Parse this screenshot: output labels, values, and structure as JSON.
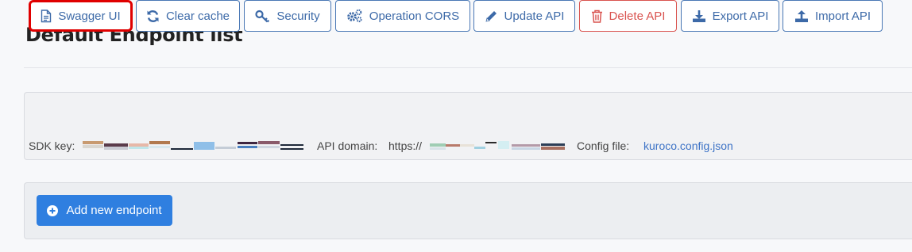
{
  "page": {
    "title": "Default Endpoint list"
  },
  "toolbar": {
    "buttons": [
      {
        "label": "Swagger UI",
        "icon": "document-icon"
      },
      {
        "label": "Clear cache",
        "icon": "refresh-icon"
      },
      {
        "label": "Security",
        "icon": "key-icon"
      },
      {
        "label": "Operation CORS",
        "icon": "gears-icon"
      },
      {
        "label": "Update API",
        "icon": "pencil-icon"
      },
      {
        "label": "Delete API",
        "icon": "trash-icon"
      },
      {
        "label": "Export API",
        "icon": "download-icon"
      },
      {
        "label": "Import API",
        "icon": "upload-icon"
      }
    ]
  },
  "info": {
    "sdk_key_label": "SDK key:",
    "api_domain_label": "API domain:",
    "api_domain_prefix": "https://",
    "config_file_label": "Config file:",
    "config_file_link": "kuroco.config.json"
  },
  "actions": {
    "add_label": "Add new endpoint"
  },
  "colors": {
    "primary": "#2f7fe0",
    "button_border": "#4a78b5",
    "danger": "#d9534f",
    "highlight": "#e00000",
    "link": "#3d73c6"
  }
}
